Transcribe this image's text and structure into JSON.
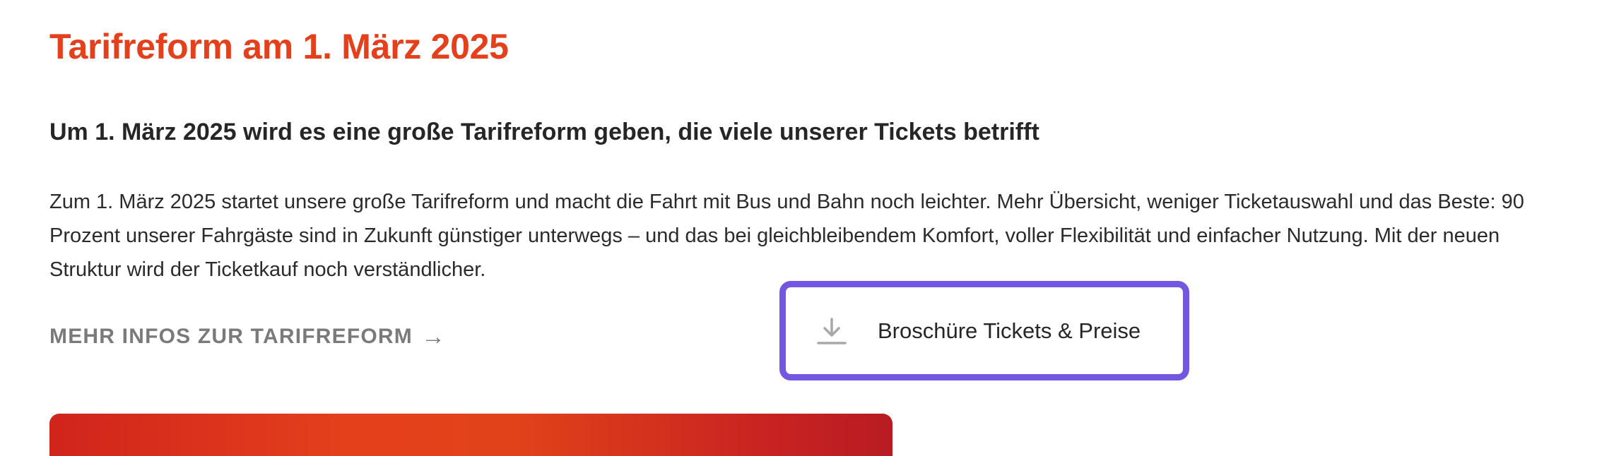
{
  "section": {
    "title": "Tarifreform am 1. März 2025",
    "subtitle": "Um 1. März 2025 wird es eine große Tarifreform geben, die viele unserer Tickets betrifft",
    "body": "Zum 1. März 2025 startet unsere große Tarifreform und macht die Fahrt mit Bus und Bahn noch leichter. Mehr Übersicht, weniger Ticketauswahl und das Beste: 90 Prozent unserer Fahrgäste sind in Zukunft günstiger unterwegs – und das bei gleichbleibendem Komfort, voller Flexibilität und einfacher Nutzung. Mit der neuen Struktur wird der Ticketkauf noch verständlicher."
  },
  "links": {
    "more_info_label": "MEHR INFOS ZUR TARIFREFORM",
    "more_info_arrow": "→"
  },
  "download": {
    "label": "Broschüre Tickets & Preise",
    "icon": "download-icon"
  },
  "colors": {
    "title": "#e4401c",
    "focus_outline": "#7357e0",
    "link_gray": "#7a7a7a",
    "banner_red": "#d0241c"
  }
}
